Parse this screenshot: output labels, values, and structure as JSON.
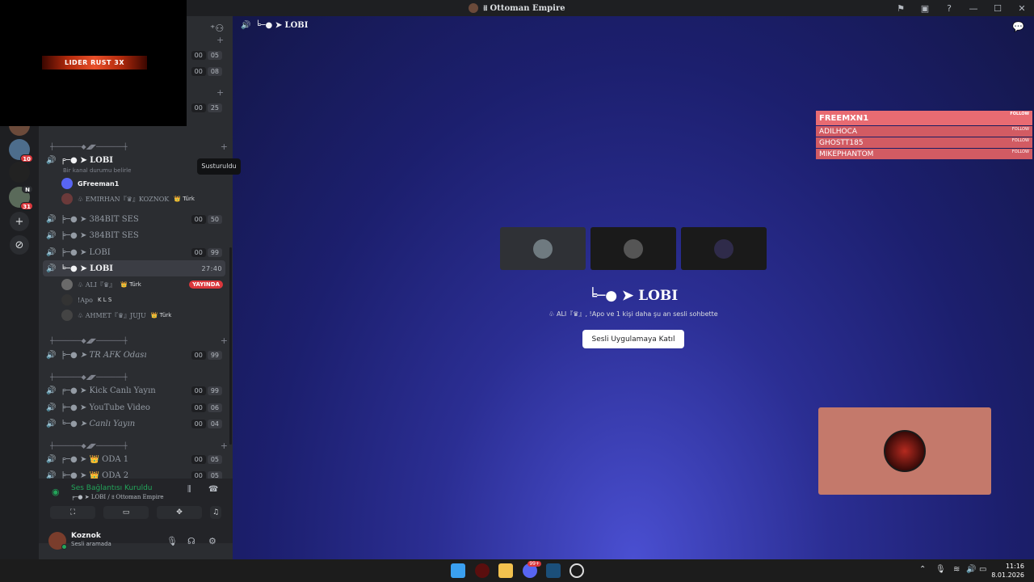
{
  "window": {
    "title": "᎒᎒ Ottoman Empire"
  },
  "overlay": {
    "banner_text": "LIDER RUST 3X"
  },
  "guilds": {
    "badge_1": "10",
    "badge_2": "N",
    "badge_3": "31"
  },
  "sidebar": {
    "tooltip": "Susturuldu",
    "status_text": "Bir kanal durumu belirle",
    "category_label": "┼───────◆◢◤───────┼",
    "top_counts": [
      {
        "a": "00",
        "b": "05"
      },
      {
        "a": "00",
        "b": "08"
      },
      {
        "a": "00",
        "b": "25"
      }
    ],
    "lobi_active": {
      "name": "╒─● ➤ LOBI"
    },
    "lobi_users": [
      {
        "name": "GFreeman1",
        "tag": ""
      },
      {
        "name": "♧ EMIRHAN『♛』KOZNOK",
        "tag": "👑 Türk"
      }
    ],
    "channels": [
      {
        "name": "╞─● ➤ 384BIT SES",
        "a": "00",
        "b": "50"
      },
      {
        "name": "╞─● ➤ 384BIT SES",
        "a": "",
        "b": ""
      },
      {
        "name": "╞─● ➤ LOBI",
        "a": "00",
        "b": "99"
      }
    ],
    "lobi_2": {
      "name": "╘─● ➤ LOBI",
      "timer": "27:40"
    },
    "lobi_2_users": [
      {
        "name": "♧ ALI『♛』",
        "tag": "👑 Türk",
        "live": "YAYINDA"
      },
      {
        "name": "!Apo",
        "tag": "K L S",
        "live": ""
      },
      {
        "name": "♧ AHMET『♛』JUJU",
        "tag": "👑 Türk",
        "live": ""
      }
    ],
    "afk": {
      "name": "╞─● ➤ TR AFK Odası",
      "a": "00",
      "b": "99"
    },
    "stream_channels": [
      {
        "name": "╒─● ➤ Kick Canlı Yayın",
        "a": "00",
        "b": "99"
      },
      {
        "name": "╞─● ➤ YouTube Video",
        "a": "00",
        "b": "06"
      },
      {
        "name": "╘─● ➤ Canlı Yayın",
        "a": "00",
        "b": "04"
      }
    ],
    "rooms": [
      {
        "name": "╒─● ➤ 👑 ODA 1",
        "a": "00",
        "b": "05"
      },
      {
        "name": "╞─● ➤ 👑 ODA 2",
        "a": "00",
        "b": "05"
      }
    ]
  },
  "voice_panel": {
    "status": "Ses Bağlantısı Kuruldu",
    "channel": "╒─● ➤ LOBI / ᎒᎒ Ottoman Empire"
  },
  "user_panel": {
    "name": "Koznok",
    "status": "Sesli aramada"
  },
  "main": {
    "header_title": "╘─● ➤ LOBI",
    "big_title": "╘─● ➤ LOBI",
    "description": "♧ ALI『♛』, !Apo ve 1 kişi daha şu an sesli sohbette",
    "join_button": "Sesli Uygulamaya Katıl"
  },
  "follow_widget": {
    "label": "FOLLOW",
    "top": "FREEMXN1",
    "rows": [
      "ADILHOCA",
      "GHOSTT185",
      "MIKEPHANTOM"
    ]
  },
  "taskbar": {
    "discord_badge": "99+",
    "time": "11:16",
    "date": "8.01.2026"
  },
  "colors": {
    "accent_green": "#23a55a",
    "live_red": "#da373c",
    "follow_pink": "#e86b72"
  }
}
